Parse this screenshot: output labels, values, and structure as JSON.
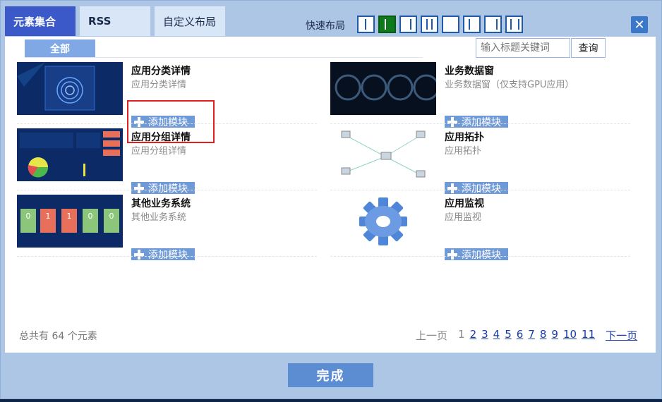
{
  "tabs": {
    "elements": "元素集合",
    "rss": "RSS",
    "custom": "自定义布局"
  },
  "layout": {
    "label": "快速布局",
    "selected_index": 1,
    "count": 8
  },
  "close_icon": "close-icon",
  "subtab": {
    "all": "全部"
  },
  "search": {
    "placeholder": "输入标题关键词",
    "button": "查询"
  },
  "items": [
    {
      "title": "应用分类详情",
      "desc": "应用分类详情",
      "add": "添加模块"
    },
    {
      "title": "业务数据窗",
      "desc": "业务数据窗（仅支持GPU应用）",
      "add": "添加模块"
    },
    {
      "title": "应用分组详情",
      "desc": "应用分组详情",
      "add": "添加模块"
    },
    {
      "title": "应用拓扑",
      "desc": "应用拓扑",
      "add": "添加模块"
    },
    {
      "title": "其他业务系统",
      "desc": "其他业务系统",
      "add": "添加模块"
    },
    {
      "title": "应用监视",
      "desc": "应用监视",
      "add": "添加模块"
    }
  ],
  "footer": {
    "total": "总共有 64 个元素"
  },
  "pager": {
    "prev": "上一页",
    "current": "1",
    "pages": [
      "2",
      "3",
      "4",
      "5",
      "6",
      "7",
      "8",
      "9",
      "10",
      "11"
    ],
    "next": "下一页"
  },
  "done": "完成",
  "thumb_text": {
    "biz_values": [
      "0",
      "1",
      "1",
      "0",
      "0"
    ]
  }
}
